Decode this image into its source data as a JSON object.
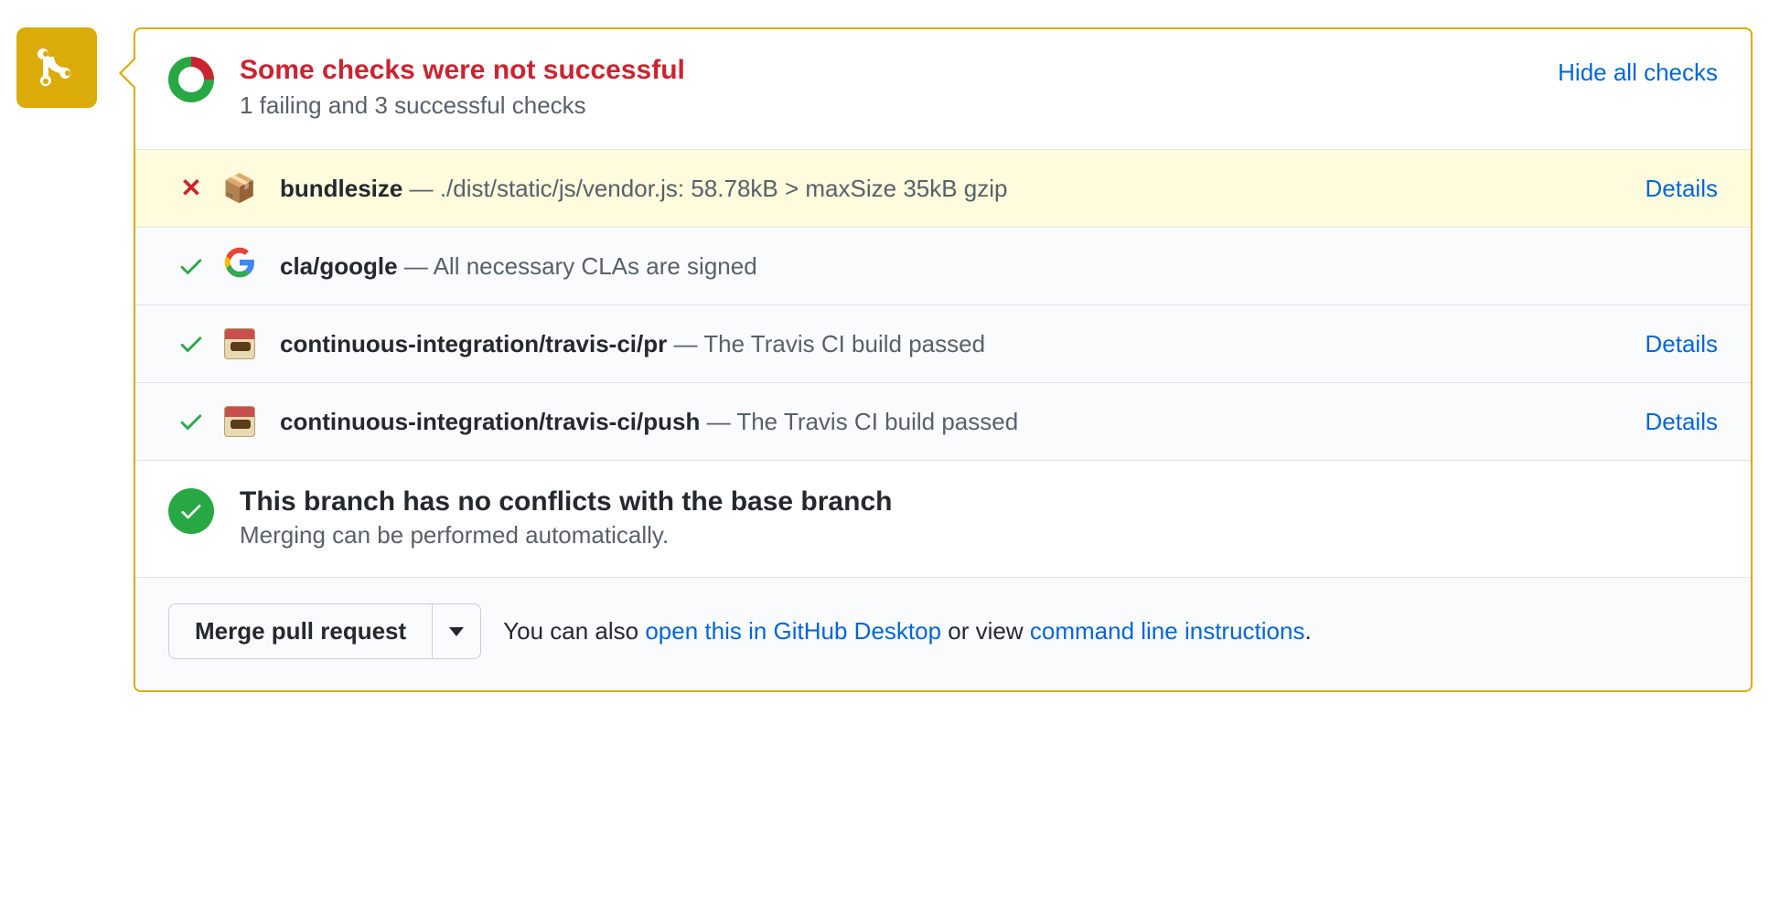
{
  "header": {
    "title": "Some checks were not successful",
    "subtitle": "1 failing and 3 successful checks",
    "hide_link": "Hide all checks"
  },
  "checks": [
    {
      "status": "fail",
      "icon": "package",
      "name": "bundlesize",
      "sep": " — ",
      "desc": "./dist/static/js/vendor.js: 58.78kB > maxSize 35kB gzip",
      "details": "Details"
    },
    {
      "status": "pass",
      "icon": "google",
      "name": "cla/google",
      "sep": " — ",
      "desc": "All necessary CLAs are signed",
      "details": ""
    },
    {
      "status": "pass",
      "icon": "travis",
      "name": "continuous-integration/travis-ci/pr",
      "sep": " — ",
      "desc": "The Travis CI build passed",
      "details": "Details"
    },
    {
      "status": "pass",
      "icon": "travis",
      "name": "continuous-integration/travis-ci/push",
      "sep": " — ",
      "desc": "The Travis CI build passed",
      "details": "Details"
    }
  ],
  "merge": {
    "title": "This branch has no conflicts with the base branch",
    "subtitle": "Merging can be performed automatically."
  },
  "footer": {
    "merge_button": "Merge pull request",
    "pre": "You can also ",
    "desktop_link": "open this in GitHub Desktop",
    "mid": " or view ",
    "cli_link": "command line instructions",
    "post": "."
  }
}
